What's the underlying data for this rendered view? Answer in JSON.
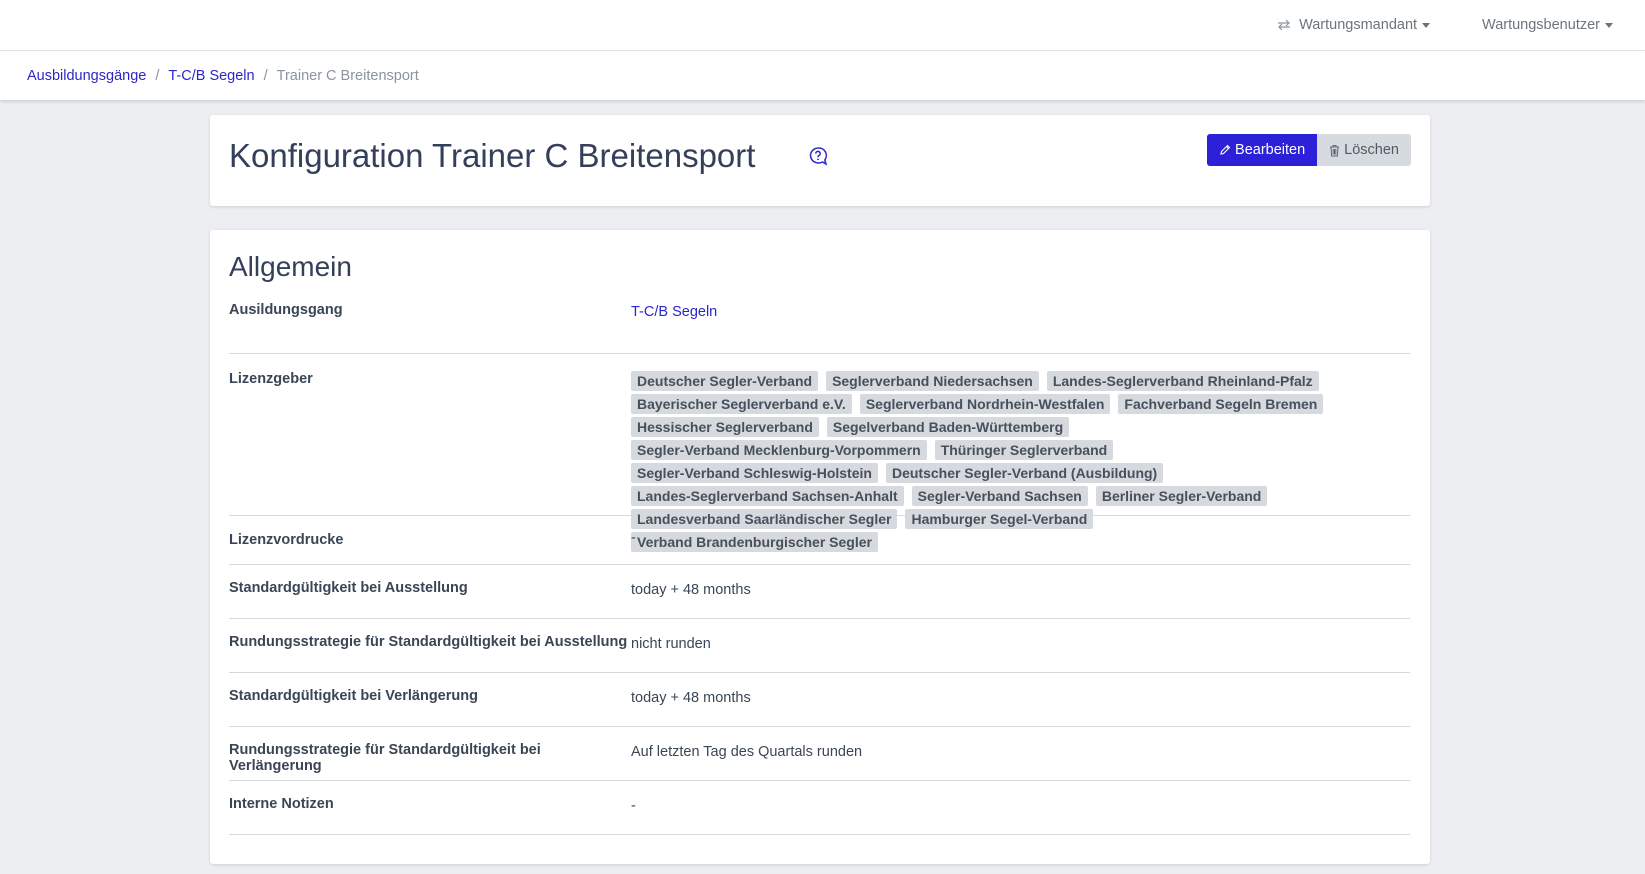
{
  "topbar": {
    "tenant_label": "Wartungsmandant",
    "user_label": "Wartungsbenutzer"
  },
  "breadcrumb": {
    "items": [
      "Ausbildungsgänge",
      "T-C/B Segeln"
    ],
    "current": "Trainer C Breitensport",
    "separator": "/"
  },
  "header": {
    "title": "Konfiguration Trainer C Breitensport",
    "edit_label": "Bearbeiten",
    "delete_label": "Löschen"
  },
  "section": {
    "title": "Allgemein",
    "rows": {
      "ausbildungsgang": {
        "label": "Ausildungsgang",
        "value": "T-C/B Segeln"
      },
      "lizenzgeber": {
        "label": "Lizenzgeber",
        "tags": [
          "Deutscher Segler-Verband",
          "Seglerverband Niedersachsen",
          "Landes-Seglerverband Rheinland-Pfalz",
          "Bayerischer Seglerverband e.V.",
          "Seglerverband Nordrhein-Westfalen",
          "Fachverband Segeln Bremen",
          "Hessischer Seglerverband",
          "Segelverband Baden-Württemberg",
          "Segler-Verband Mecklenburg-Vorpommern",
          "Thüringer Seglerverband",
          "Segler-Verband Schleswig-Holstein",
          "Deutscher Segler-Verband (Ausbildung)",
          "Landes-Seglerverband Sachsen-Anhalt",
          "Segler-Verband Sachsen",
          "Berliner Segler-Verband",
          "Landesverband Saarländischer Segler",
          "Hamburger Segel-Verband",
          "Verband Brandenburgischer Segler"
        ]
      },
      "lizenzvordrucke": {
        "label": "Lizenzvordrucke",
        "value": "-"
      },
      "gueltigkeit_ausstellung": {
        "label": "Standardgültigkeit bei Ausstellung",
        "value": "today + 48 months"
      },
      "rundung_ausstellung": {
        "label": "Rundungsstrategie für Standardgültigkeit bei Ausstellung",
        "value": "nicht runden"
      },
      "gueltigkeit_verlaengerung": {
        "label": "Standardgültigkeit bei Verlängerung",
        "value": "today + 48 months"
      },
      "rundung_verlaengerung": {
        "label": "Rundungsstrategie für Standardgültigkeit bei Verlängerung",
        "value": "Auf letzten Tag des Quartals runden"
      },
      "notizen": {
        "label": "Interne Notizen",
        "value": "-"
      }
    }
  },
  "colors": {
    "primary": "#2c20d8",
    "link": "#2c27c8",
    "tag_bg": "#d6d9dd",
    "page_bg": "#eceef1"
  }
}
